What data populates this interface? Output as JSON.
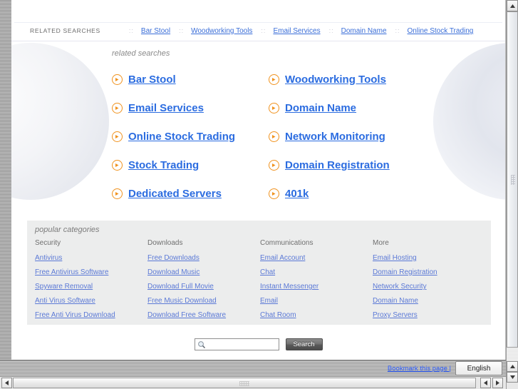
{
  "top_strip": {
    "label": "RELATED SEARCHES",
    "separator": "::",
    "links": [
      "Bar Stool",
      "Woodworking Tools",
      "Email Services",
      "Domain Name",
      "Online Stock Trading"
    ]
  },
  "related_searches": {
    "title": "related searches",
    "items": [
      "Bar Stool",
      "Woodworking Tools",
      "Email Services",
      "Domain Name",
      "Online Stock Trading",
      "Network Monitoring",
      "Stock Trading",
      "Domain Registration",
      "Dedicated Servers",
      "401k"
    ]
  },
  "popular_categories": {
    "title": "popular categories",
    "columns": [
      {
        "heading": "Security",
        "links": [
          "Antivirus",
          "Free Antivirus Software",
          "Spyware Removal",
          "Anti Virus Software",
          "Free Anti Virus Download"
        ]
      },
      {
        "heading": "Downloads",
        "links": [
          "Free Downloads",
          "Download Music",
          "Download Full Movie",
          "Free Music Download",
          "Download Free Software"
        ]
      },
      {
        "heading": "Communications",
        "links": [
          "Email Account",
          "Chat",
          "Instant Messenger",
          "Email",
          "Chat Room"
        ]
      },
      {
        "heading": "More",
        "links": [
          "Email Hosting",
          "Domain Registration",
          "Network Security",
          "Domain Name",
          "Proxy Servers"
        ]
      }
    ]
  },
  "search": {
    "value": "",
    "placeholder": "",
    "button_label": "Search",
    "icon": "magnifier-icon"
  },
  "footer": {
    "bookmark_label": "Bookmark this page |",
    "language_value": "English"
  },
  "icons": {
    "bullet": "orange-arrow-circle-icon",
    "scroll_up": "scroll-up-arrow-icon",
    "scroll_down": "scroll-down-arrow-icon",
    "scroll_left": "scroll-left-arrow-icon",
    "scroll_right": "scroll-right-arrow-icon",
    "dropdown": "chevron-down-icon"
  },
  "colors": {
    "link_blue": "#2b6ce0",
    "bullet_orange": "#f0921e",
    "category_bg": "#eceded",
    "muted_text": "#7c7c7c"
  }
}
